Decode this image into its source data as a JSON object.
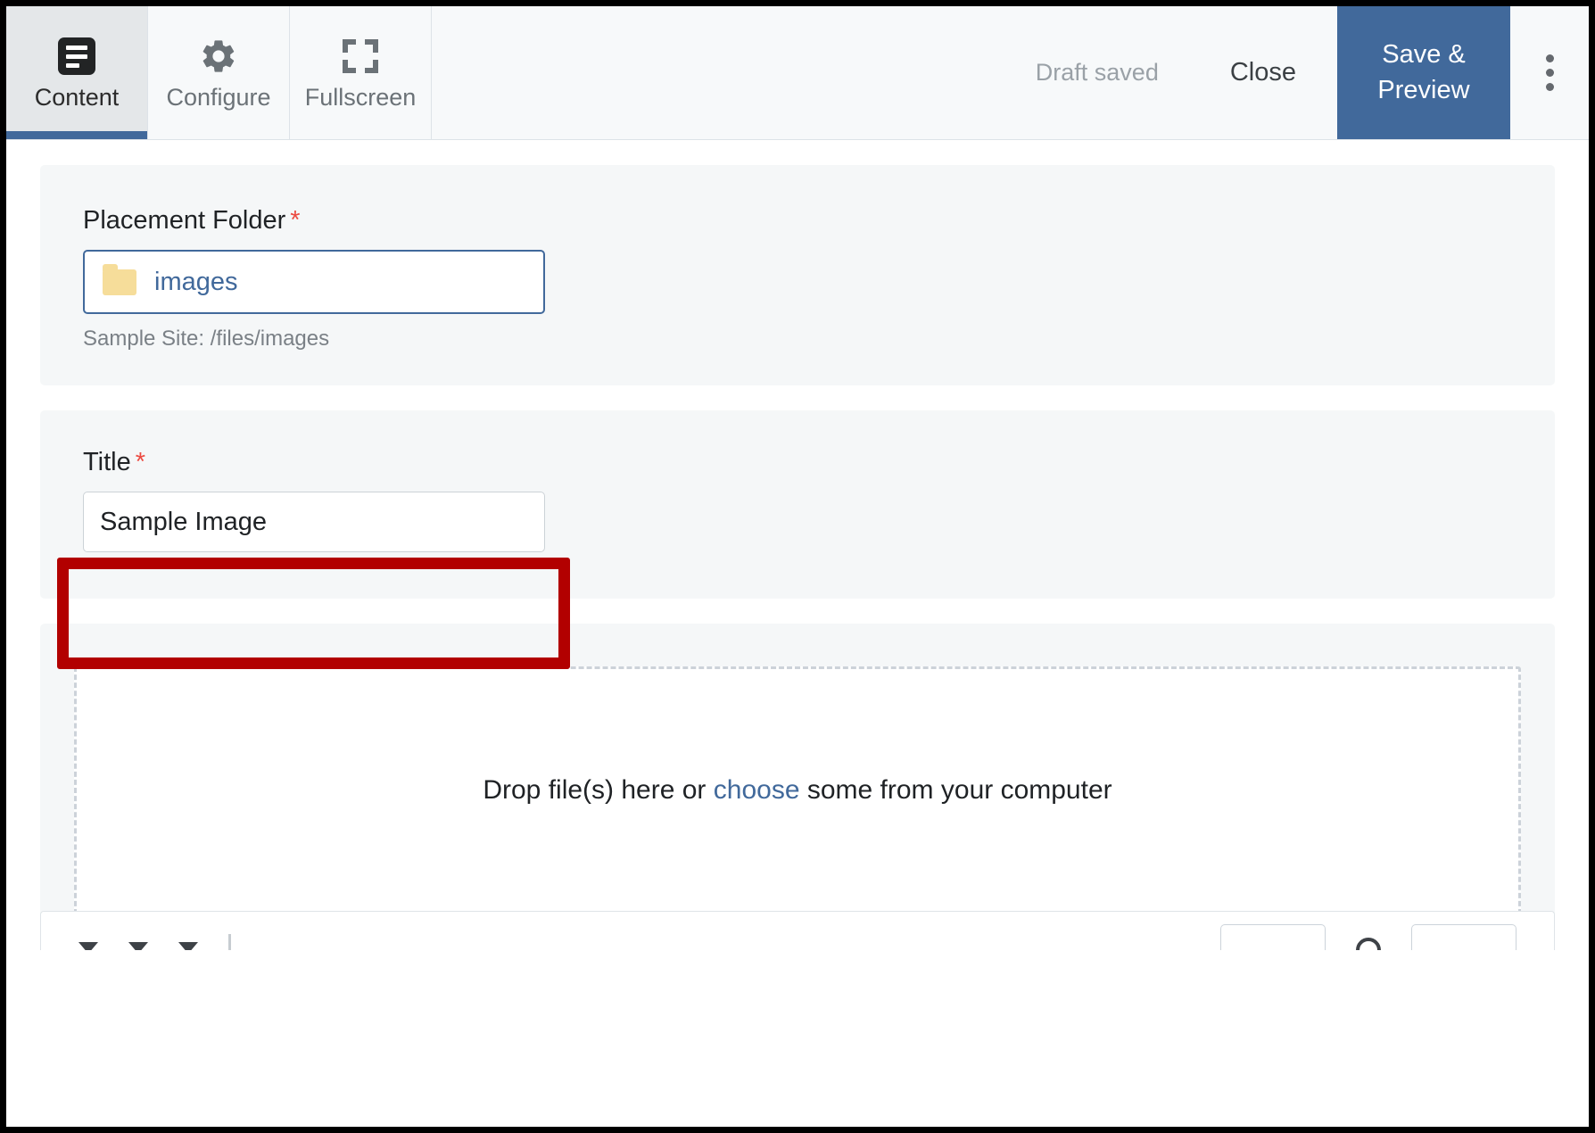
{
  "toolbar": {
    "tabs": [
      {
        "label": "Content",
        "icon": "document-icon",
        "active": true
      },
      {
        "label": "Configure",
        "icon": "gear-icon",
        "active": false
      },
      {
        "label": "Fullscreen",
        "icon": "fullscreen-icon",
        "active": false
      }
    ],
    "draft_status": "Draft saved",
    "close_label": "Close",
    "save_preview_label": "Save & Preview",
    "overflow_icon": "kebab-menu-icon",
    "accent_color": "#41699b",
    "active_tab_bg": "#e4e7e9"
  },
  "form": {
    "placement_folder": {
      "label": "Placement Folder",
      "required_marker": "*",
      "value": "images",
      "icon": "folder-icon",
      "help_text": "Sample Site: /files/images"
    },
    "title": {
      "label": "Title",
      "required_marker": "*",
      "value": "Sample Image"
    },
    "upload": {
      "prefix_text": "Drop file(s) here or ",
      "link_text": "choose",
      "suffix_text": " some from your computer"
    }
  },
  "annotation": {
    "type": "highlight-rectangle",
    "color": "#b20000",
    "target": "title-input"
  },
  "colors": {
    "panel_bg": "#f5f7f8",
    "page_bg": "#ffffff",
    "required_red": "#ec4b42",
    "link_blue": "#41699b",
    "folder_yellow": "#f6dd9a",
    "muted_text": "#7a8086"
  }
}
